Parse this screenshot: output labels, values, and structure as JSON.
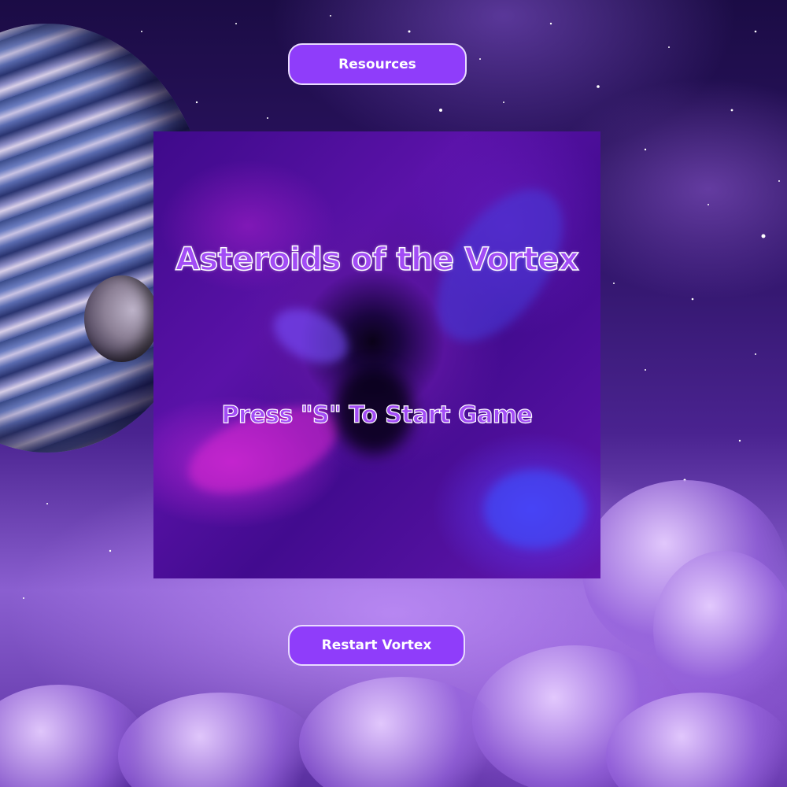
{
  "nav": {
    "resources_label": "Resources",
    "restart_label": "Restart Vortex"
  },
  "game": {
    "title": "Asteroids of the Vortex",
    "prompt": "Press \"S\" To Start Game"
  },
  "colors": {
    "button_fill": "#8f3dfa",
    "button_border": "#e9dcff",
    "title_fill": "#a24cf5",
    "title_outline": "#ffffff"
  },
  "decor": {
    "background": "purple-nebula-space",
    "planet": "striped-gas-giant-icon",
    "moon": "grey-moon-icon",
    "clouds": "purple-cloud-bank"
  }
}
